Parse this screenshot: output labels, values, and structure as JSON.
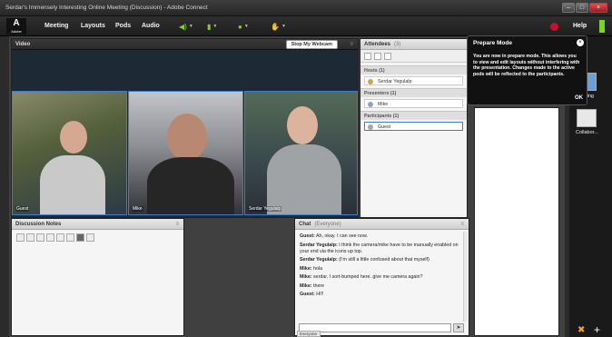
{
  "window": {
    "title": "Serdar's Immensely Interesting Online Meeting (Discussion) - Adobe Connect"
  },
  "menubar": {
    "logo": "A",
    "logo_sub": "Adobe",
    "menus": [
      "Meeting",
      "Layouts",
      "Pods",
      "Audio"
    ],
    "help": "Help"
  },
  "video_pod": {
    "title": "Video",
    "stop_button": "Stop My Webcam",
    "tiles": [
      {
        "label": "Guest"
      },
      {
        "label": "Mike"
      },
      {
        "label": "Serdar Yegulalp"
      }
    ]
  },
  "attendees_pod": {
    "title": "Attendees",
    "count": "(3)",
    "groups": [
      {
        "label": "Hosts (1)",
        "people": [
          "Serdar Yegulalp"
        ]
      },
      {
        "label": "Presenters (1)",
        "people": [
          "Mike"
        ]
      },
      {
        "label": "Participants (1)",
        "people": [
          "Guest"
        ]
      }
    ]
  },
  "prepare_mode": {
    "title": "Prepare Mode",
    "body": "You are now in prepare mode. This allows you to view and edit layouts without interfering with the presentation. Changes made to the active pods will be reflected to the participants.",
    "ok": "OK"
  },
  "side_panel": {
    "items": [
      {
        "label": "Sharing"
      },
      {
        "label": "Collabor..."
      }
    ]
  },
  "notes_pod": {
    "title": "Discussion Notes"
  },
  "chat_pod": {
    "title": "Chat",
    "audience": "(Everyone)",
    "messages": [
      {
        "from": "Guest:",
        "text": "Ah, okay. I can see now."
      },
      {
        "from": "Serdar Yegulalp:",
        "text": "I think the camera/mike have to be manually enabled on your end via the icons up top."
      },
      {
        "from": "Serdar Yegulalp:",
        "text": "(I'm still a little confused about that myself)"
      },
      {
        "from": "Mike:",
        "text": "hola"
      },
      {
        "from": "Mike:",
        "text": "serdar, I sort-bumped here. give me camera again?"
      },
      {
        "from": "Mike:",
        "text": "there"
      },
      {
        "from": "Guest:",
        "text": "HI!!"
      }
    ],
    "tab_label": "Everyone"
  },
  "colors": {
    "accent": "#3a7ed1",
    "record": "#c8102e",
    "audio": "#7ed321"
  }
}
